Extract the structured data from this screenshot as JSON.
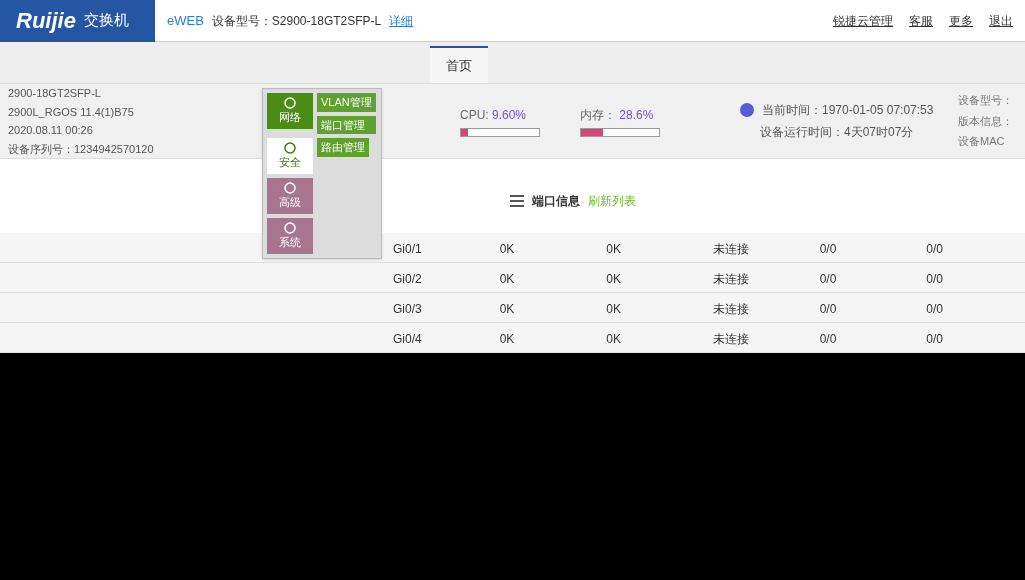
{
  "header": {
    "brand": "Ruijie",
    "product": "交换机",
    "eweb": "eWEB",
    "model": "设备型号：S2900-18GT2SFP-L",
    "detail_link": "详细",
    "links": [
      "锐捷云管理",
      "客服",
      "更多",
      "退出"
    ]
  },
  "nav": {
    "tabs": [
      {
        "label": "首页",
        "selected": true
      }
    ]
  },
  "menu": {
    "categories": [
      {
        "label": "网络",
        "children": [
          "VLAN管理",
          "端口管理"
        ]
      },
      {
        "label": "安全",
        "children": [
          "路由管理"
        ]
      },
      {
        "label": "高级"
      },
      {
        "label": "系统"
      }
    ]
  },
  "device": {
    "lines": [
      "2900-18GT2SFP-L",
      "2900L_RGOS 11.4(1)B75",
      "2020.08.11 00:26",
      "设备序列号：1234942570120"
    ]
  },
  "stats": [
    {
      "label": "CPU:",
      "value": "9.60%",
      "level": 0.096
    },
    {
      "label": "内存：",
      "value": "28.6%",
      "level": 0.286
    }
  ],
  "status": {
    "time": "当前时间：1970-01-05 07:07:53",
    "uptime": "设备运行时间：4天07时07分"
  },
  "info_labels": [
    "设备型号：",
    "版本信息：",
    "设备MAC"
  ],
  "ports": {
    "title": "端口信息",
    "refresh": "刷新列表",
    "rows": [
      [
        "Gi0/1",
        "0K",
        "0K",
        "未连接",
        "0/0",
        "0/0"
      ],
      [
        "Gi0/2",
        "0K",
        "0K",
        "未连接",
        "0/0",
        "0/0"
      ],
      [
        "Gi0/3",
        "0K",
        "0K",
        "未连接",
        "0/0",
        "0/0"
      ],
      [
        "Gi0/4",
        "0K",
        "0K",
        "未连接",
        "0/0",
        "0/0"
      ]
    ]
  }
}
